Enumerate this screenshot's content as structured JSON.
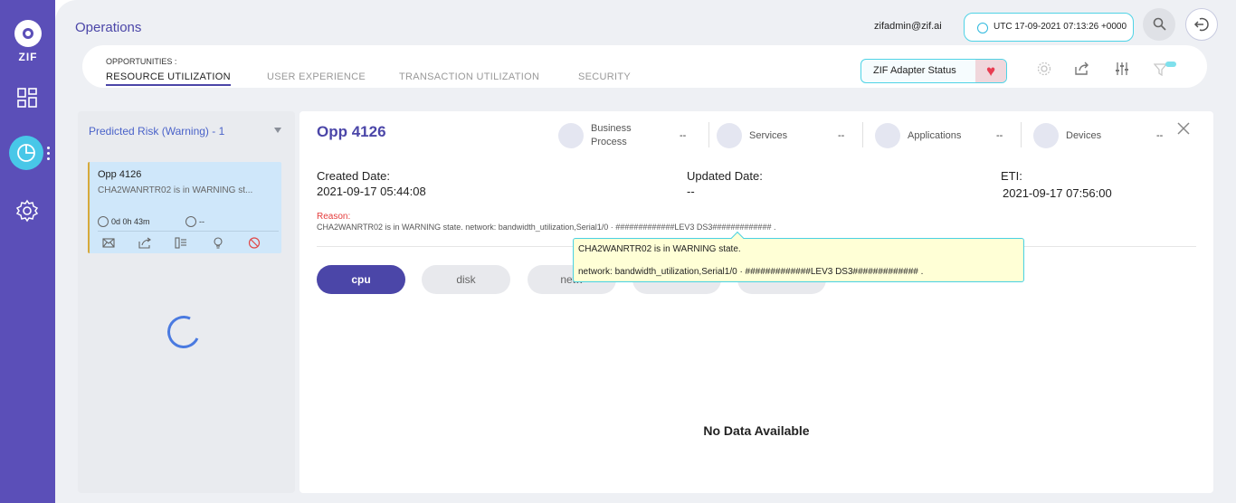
{
  "app": {
    "logo_text": "ZIF"
  },
  "header": {
    "title": "Operations",
    "user": "zifadmin@zif.ai",
    "datetime": "UTC 17-09-2021 07:13:26 +0000"
  },
  "tabs": {
    "caption": "OPPORTUNITIES :",
    "items": [
      {
        "label": "RESOURCE UTILIZATION",
        "active": true
      },
      {
        "label": "USER EXPERIENCE",
        "active": false
      },
      {
        "label": "TRANSACTION UTILIZATION",
        "active": false
      },
      {
        "label": "SECURITY",
        "active": false
      }
    ],
    "adapter_status_label": "ZIF Adapter Status"
  },
  "left_panel": {
    "filter_label": "Predicted Risk (Warning) - 1",
    "card": {
      "title": "Opp 4126",
      "description": "CHA2WANRTR02 is in WARNING st...",
      "elapsed": "0d 0h 43m",
      "remaining": "--"
    }
  },
  "detail": {
    "title": "Opp 4126",
    "categories": [
      {
        "label": "Business Process",
        "value": "--",
        "icon": "business-process-icon"
      },
      {
        "label": "Services",
        "value": "--",
        "icon": "services-icon"
      },
      {
        "label": "Applications",
        "value": "--",
        "icon": "applications-icon"
      },
      {
        "label": "Devices",
        "value": "--",
        "icon": "devices-icon"
      }
    ],
    "created_label": "Created Date:",
    "created_value": "2021-09-17 05:44:08",
    "updated_label": "Updated Date:",
    "updated_value": "--",
    "eti_label": "ETI:",
    "eti_value": "2021-09-17 07:56:00",
    "reason_label": "Reason:",
    "reason_text": "CHA2WANRTR02 is in WARNING state. network: bandwidth_utilization,Serial1/0 · #############LEV3 DS3############# .",
    "tooltip_line1": "CHA2WANRTR02 is in WARNING state.",
    "tooltip_line2": "network: bandwidth_utilization,Serial1/0 · #############LEV3 DS3############# .",
    "metric_tabs": [
      "cpu",
      "disk",
      "netw",
      "",
      ""
    ],
    "empty_message": "No Data Available"
  },
  "colors": {
    "rail": "#5b4fb8",
    "accent": "#4b46a8",
    "highlight": "#48c7e8",
    "warning_border": "#d7a93a"
  }
}
